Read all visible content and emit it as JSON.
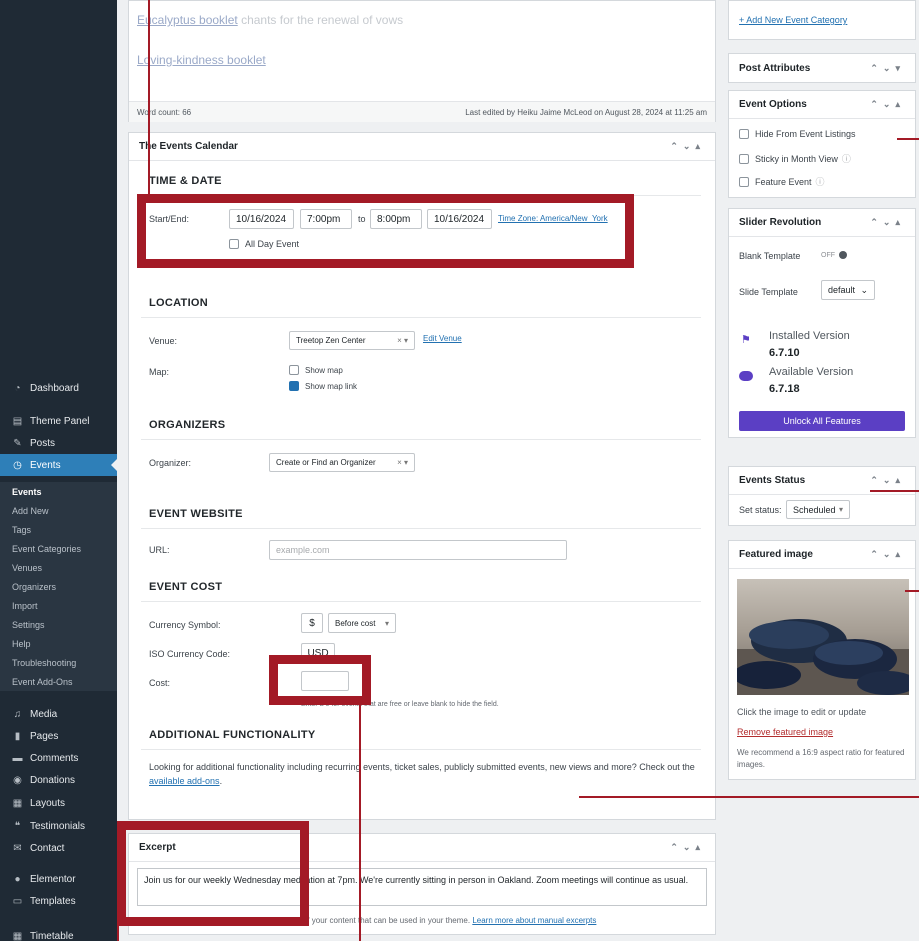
{
  "sidebar": {
    "items": [
      {
        "label": "Dashboard",
        "icon": "dashboard-icon"
      },
      {
        "label": "Theme Panel",
        "icon": "panel-icon"
      },
      {
        "label": "Posts",
        "icon": "pin-icon"
      },
      {
        "label": "Events",
        "icon": "events-icon"
      },
      {
        "label": "Media",
        "icon": "media-icon"
      },
      {
        "label": "Pages",
        "icon": "pages-icon"
      },
      {
        "label": "Comments",
        "icon": "comments-icon"
      },
      {
        "label": "Donations",
        "icon": "donations-icon"
      },
      {
        "label": "Layouts",
        "icon": "layouts-icon"
      },
      {
        "label": "Testimonials",
        "icon": "testimonials-icon"
      },
      {
        "label": "Contact",
        "icon": "mail-icon"
      },
      {
        "label": "Elementor",
        "icon": "elementor-icon"
      },
      {
        "label": "Templates",
        "icon": "folder-icon"
      },
      {
        "label": "Timetable",
        "icon": "calendar-icon"
      }
    ],
    "events_sub": [
      "Events",
      "Add New",
      "Tags",
      "Event Categories",
      "Venues",
      "Organizers",
      "Import",
      "Settings",
      "Help",
      "Troubleshooting",
      "Event Add-Ons"
    ]
  },
  "editor": {
    "line1_link": "Eucalyptus booklet",
    "line1_rest": " chants for the renewal of vows",
    "line2_link": "Loving-kindness booklet",
    "word_count": "Word count: 66",
    "last_edited": "Last edited by Heiku Jaime McLeod on August 28, 2024 at 11:25 am"
  },
  "events_calendar": {
    "title": "The Events Calendar",
    "time_date": {
      "heading": "TIME & DATE",
      "start_end_label": "Start/End:",
      "start_date": "10/16/2024",
      "start_time": "7:00pm",
      "to": "to",
      "end_time": "8:00pm",
      "end_date": "10/16/2024",
      "timezone": "Time Zone: America/New_York",
      "all_day": "All Day Event"
    },
    "location": {
      "heading": "LOCATION",
      "venue_label": "Venue:",
      "venue_value": "Treetop Zen Center",
      "edit_venue": "Edit Venue",
      "map_label": "Map:",
      "show_map": "Show map",
      "show_map_link": "Show map link"
    },
    "organizers": {
      "heading": "ORGANIZERS",
      "organizer_label": "Organizer:",
      "organizer_value": "Create or Find an Organizer"
    },
    "website": {
      "heading": "EVENT WEBSITE",
      "url_label": "URL:",
      "url_placeholder": "example.com"
    },
    "cost": {
      "heading": "EVENT COST",
      "currency_symbol_label": "Currency Symbol:",
      "currency_symbol": "$",
      "currency_position": "Before cost",
      "iso_label": "ISO Currency Code:",
      "iso_value": "USD",
      "cost_label": "Cost:",
      "cost_help": "Enter a 0 for events that are free or leave blank to hide the field."
    },
    "additional": {
      "heading": "ADDITIONAL FUNCTIONALITY",
      "text": "Looking for additional functionality including recurring events, ticket sales, publicly submitted events, new views and more? Check out the",
      "link": "available add-ons",
      "end": "."
    }
  },
  "excerpt": {
    "title": "Excerpt",
    "text": "Join us for our weekly Wednesday meditation at 7pm. We're currently sitting in person in Oakland. Zoom meetings will continue as usual.",
    "help_prefix": "Excerpts are optional hand-crafted summaries of your content that can be used in your theme.",
    "help_link": "Learn more about manual excerpts"
  },
  "right": {
    "add_category": "+ Add New Event Category",
    "post_attributes": "Post Attributes",
    "event_options": {
      "title": "Event Options",
      "hide": "Hide From Event Listings",
      "sticky": "Sticky in Month View",
      "feature": "Feature Event"
    },
    "slider": {
      "title": "Slider Revolution",
      "blank_template": "Blank Template",
      "toggle": "OFF",
      "slide_template": "Slide Template",
      "slide_value": "default",
      "installed_label": "Installed Version",
      "installed_version": "6.7.10",
      "available_label": "Available Version",
      "available_version": "6.7.18",
      "unlock": "Unlock All Features"
    },
    "events_status": {
      "title": "Events Status",
      "set_status": "Set status:",
      "value": "Scheduled"
    },
    "featured": {
      "title": "Featured image",
      "edit_hint": "Click the image to edit or update",
      "remove": "Remove featured image",
      "recommend": "We recommend a 16:9 aspect ratio for featured images."
    }
  },
  "colors": {
    "annotation_red": "#a31a26",
    "admin_sidebar": "#1f2a35",
    "active_blue": "#2e7fb8",
    "unlock_purple": "#5b3fc4"
  }
}
